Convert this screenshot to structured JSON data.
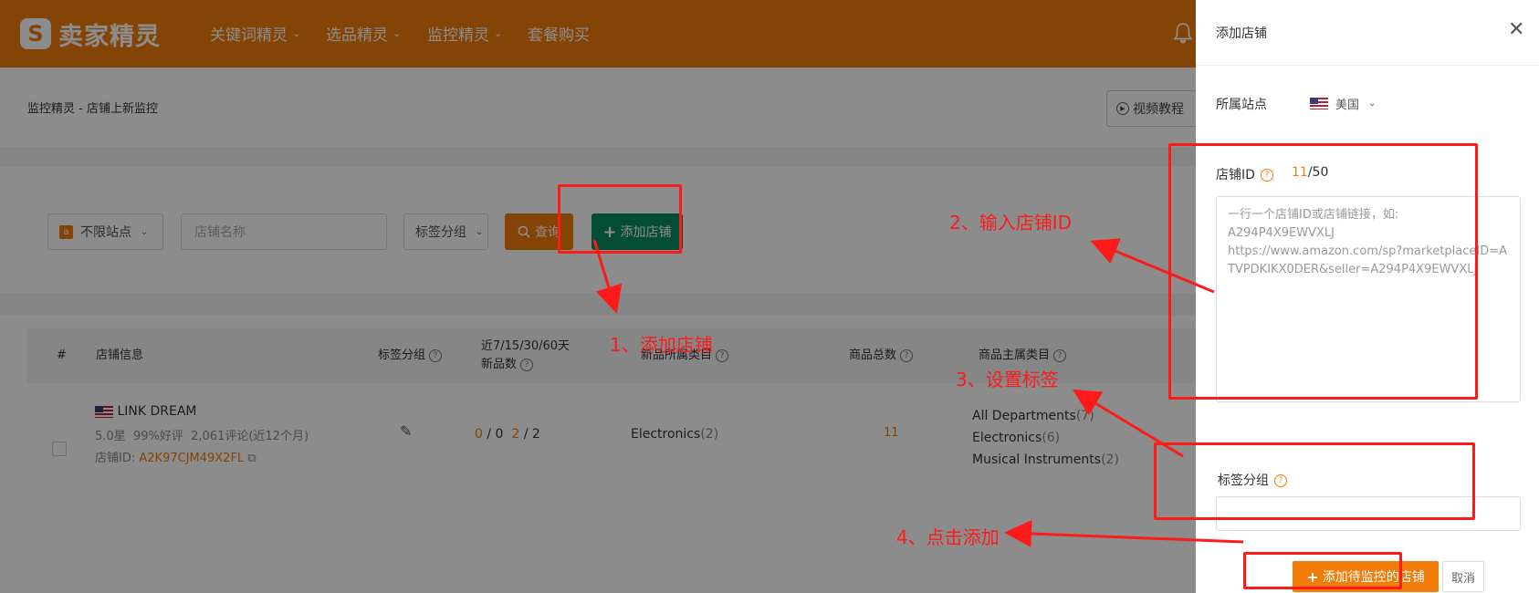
{
  "app": {
    "logo_text": "卖家精灵",
    "logo_mark": "S"
  },
  "nav": {
    "items": [
      {
        "label": "关键词精灵",
        "has_chevron": true
      },
      {
        "label": "选品精灵",
        "has_chevron": true
      },
      {
        "label": "监控精灵",
        "has_chevron": true
      },
      {
        "label": "套餐购买",
        "has_chevron": false
      }
    ],
    "chevron": "⌄",
    "bell_icon": "bell-icon"
  },
  "page": {
    "breadcrumb": "监控精灵 - 店铺上新监控",
    "tutorial_label": "视频教程"
  },
  "filters": {
    "site_label": "不限站点",
    "site_icon_text": "a",
    "store_placeholder": "店铺名称",
    "tag_label": "标签分组",
    "query_label": "查询",
    "add_store_label": "添加店铺"
  },
  "table": {
    "headers": {
      "index": "#",
      "store_info": "店铺信息",
      "tag_group": "标签分组",
      "new_count_line1": "近7/15/30/60天",
      "new_count_line2": "新品数",
      "new_category": "新品所属类目",
      "total_products": "商品总数",
      "main_category": "商品主属类目"
    },
    "row": {
      "store_name": "LINK DREAM",
      "rating": "5.0星",
      "positive": "99%好评",
      "reviews": "2,061评论(近12个月)",
      "store_id_label": "店铺ID:",
      "store_id": "A2K97CJM49X2FL",
      "counts": [
        "0",
        "0",
        "2",
        "2"
      ],
      "count_sep": "/",
      "new_category": "Electronics",
      "new_category_count": "(2)",
      "total": "11",
      "main_categories": [
        {
          "name": "All Departments",
          "count": "(7)"
        },
        {
          "name": "Electronics",
          "count": "(6)"
        },
        {
          "name": "Musical Instruments",
          "count": "(2)"
        }
      ]
    }
  },
  "drawer": {
    "title": "添加店铺",
    "close": "✕",
    "site_label": "所属站点",
    "site_value": "美国",
    "store_id_label": "店铺ID",
    "count_current": "11",
    "count_max": "/50",
    "textarea_placeholder": "一行一个店铺ID或店铺链接，如:\nA294P4X9EWVXLJ\nhttps://www.amazon.com/sp?marketplaceID=ATVPDKIKX0DER&seller=A294P4X9EWVXLJ",
    "tag_label": "标签分组",
    "submit_label": "添加待监控的店铺",
    "cancel_label": "取消"
  },
  "annotations": {
    "step1": "1、添加店铺",
    "step2": "2、输入店铺ID",
    "step3": "3、设置标签",
    "step4": "4、点击添加",
    "color": "#ff1a1a"
  },
  "colors": {
    "brand": "#f07c0a",
    "green": "#0a8a5f"
  }
}
